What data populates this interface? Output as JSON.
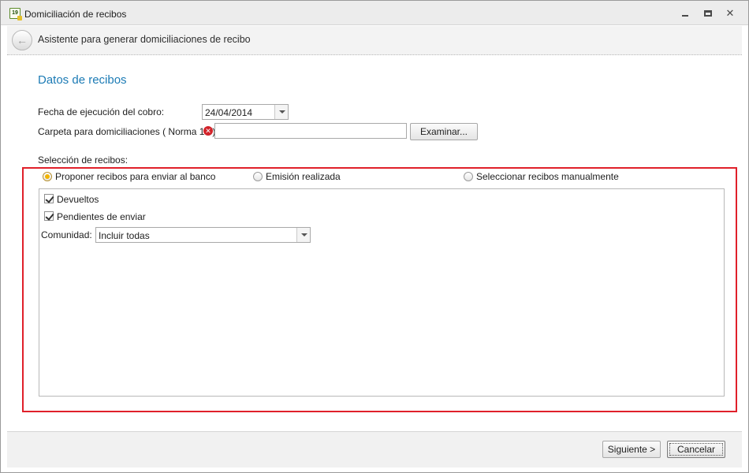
{
  "window": {
    "title": "Domiciliación de recibos",
    "app_icon_text": "19",
    "controls": {
      "minimize": "minimize",
      "maximize": "maximize",
      "close": "✕"
    }
  },
  "wizard": {
    "title": "Asistente para generar domiciliaciones de recibo"
  },
  "section": {
    "title": "Datos de recibos"
  },
  "fields": {
    "fecha_label": "Fecha de ejecución del cobro:",
    "fecha_value": "24/04/2014",
    "carpeta_label": "Carpeta para domiciliaciones ( Norma 19 ):",
    "carpeta_value": "",
    "browse_label": "Examinar..."
  },
  "seleccion": {
    "label": "Selección de recibos:",
    "options": [
      {
        "label": "Proponer recibos para enviar al banco",
        "checked": true
      },
      {
        "label": "Emisión realizada",
        "checked": false
      },
      {
        "label": "Seleccionar recibos manualmente",
        "checked": false
      }
    ]
  },
  "panel": {
    "checks": [
      {
        "label": "Devueltos",
        "checked": true
      },
      {
        "label": "Pendientes de enviar",
        "checked": true
      }
    ],
    "comunidad_label": "Comunidad:",
    "comunidad_value": "Incluir todas"
  },
  "footer": {
    "next_label": "Siguiente >",
    "cancel_label": "Cancelar"
  },
  "colors": {
    "accent": "#1c7bb5",
    "highlight_frame": "#e0202a",
    "radio_selected": "#f2b400",
    "error": "#d2232a"
  },
  "icons": [
    "app-icon",
    "minimize-icon",
    "maximize-icon",
    "close-icon",
    "back-arrow-icon",
    "error-icon",
    "dropdown-arrow-icon"
  ]
}
